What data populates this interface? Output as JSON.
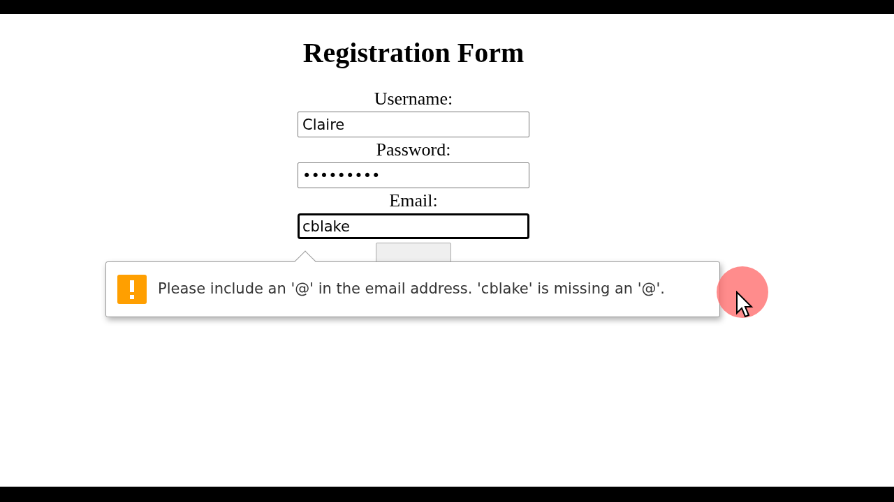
{
  "form": {
    "title": "Registration Form",
    "fields": [
      {
        "label": "Username:",
        "value": "Claire",
        "focused": false
      },
      {
        "label": "Password:",
        "value": "•••••••••",
        "focused": false
      },
      {
        "label": "Email:",
        "value": "cblake",
        "focused": true
      }
    ],
    "submit": {
      "kind": "button"
    }
  },
  "validation_tooltip": {
    "message": "Please include an '@' in the email address. 'cblake' is missing an '@'."
  }
}
